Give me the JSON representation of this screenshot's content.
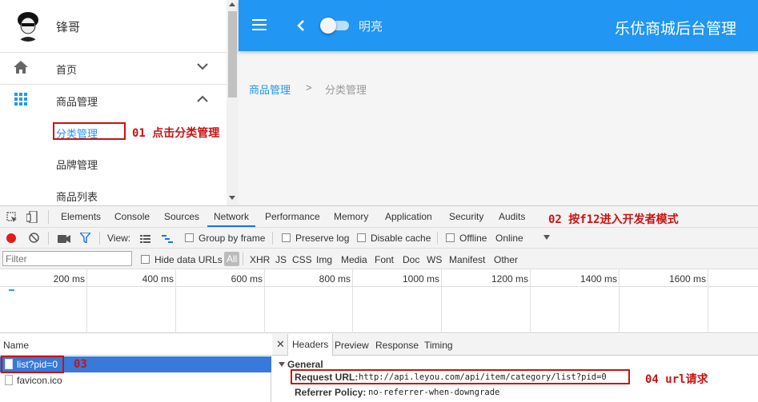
{
  "user": {
    "name": "锋哥"
  },
  "sidebar": {
    "items": [
      {
        "label": "首页",
        "icon": "home-icon"
      },
      {
        "label": "商品管理",
        "icon": "grid-apps-icon"
      }
    ],
    "subitems": [
      {
        "label": "分类管理"
      },
      {
        "label": "品牌管理"
      },
      {
        "label": "商品列表"
      }
    ]
  },
  "appbar": {
    "theme_label": "明亮",
    "title": "乐优商城后台管理"
  },
  "breadcrumb": {
    "parent": "商品管理",
    "separator": ">",
    "current": "分类管理"
  },
  "annotations": {
    "a1": "01 点击分类管理",
    "a2": "02 按f12进入开发者模式",
    "a3": "03",
    "a4": "04 url请求"
  },
  "devtools": {
    "tabs": [
      "Elements",
      "Console",
      "Sources",
      "Network",
      "Performance",
      "Memory",
      "Application",
      "Security",
      "Audits"
    ],
    "active_tab": "Network",
    "toolbar": {
      "view_label": "View:",
      "group_by_frame": "Group by frame",
      "preserve_log": "Preserve log",
      "disable_cache": "Disable cache",
      "offline": "Offline",
      "online": "Online"
    },
    "filter": {
      "placeholder": "Filter",
      "hide_data_urls": "Hide data URLs",
      "all": "All",
      "types": [
        "XHR",
        "JS",
        "CSS",
        "Img",
        "Media",
        "Font",
        "Doc",
        "WS",
        "Manifest",
        "Other"
      ]
    },
    "timeline": {
      "ticks": [
        "200 ms",
        "400 ms",
        "600 ms",
        "800 ms",
        "1000 ms",
        "1200 ms",
        "1400 ms",
        "1600 ms"
      ]
    },
    "requests": {
      "header": "Name",
      "rows": [
        "list?pid=0",
        "favicon.ico"
      ]
    },
    "detail": {
      "tabs": [
        "Headers",
        "Preview",
        "Response",
        "Timing"
      ],
      "section": "General",
      "request_url_label": "Request URL:",
      "request_url": "http://api.leyou.com/api/item/category/list?pid=0",
      "referrer_label": "Referrer Policy:",
      "referrer": "no-referrer-when-downgrade"
    }
  },
  "colors": {
    "primary": "#2196f3",
    "annotation": "#cc1111",
    "selected_row": "#3879d9"
  }
}
